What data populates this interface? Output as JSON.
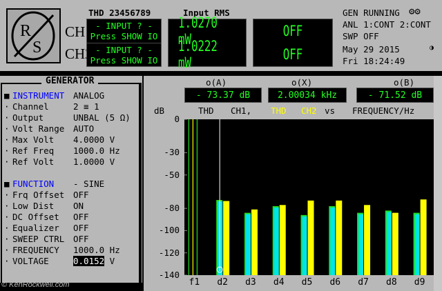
{
  "header": {
    "thd_label": "THD 23456789",
    "input_rms_label": "Input RMS",
    "logo_text": "R/S",
    "ch1_label": "CH1",
    "ch2_label": "CH2",
    "ch1_lines": [
      "- INPUT ? -",
      "Press SHOW IO"
    ],
    "ch2_lines": [
      "- INPUT ? -",
      "Press SHOW IO"
    ],
    "ch1_rms": "1.0270 mW",
    "ch2_rms": "1.0222 mW",
    "ch1_status": "OFF",
    "ch2_status": "OFF",
    "gen_running": "GEN RUNNING",
    "anl": "ANL 1:CONT 2:CONT",
    "swp": "SWP OFF",
    "date": "May 29 2015",
    "time": "Fri  18:24:49"
  },
  "generator": {
    "title": "GENERATOR",
    "rows": [
      {
        "mark": "■",
        "name": "INSTRUMENT",
        "value": "ANALOG",
        "head": true
      },
      {
        "mark": "·",
        "name": "Channel",
        "value": "2 ≡ 1"
      },
      {
        "mark": "·",
        "name": "Output",
        "value": "UNBAL (5 Ω)"
      },
      {
        "mark": "·",
        "name": "Volt Range",
        "value": "AUTO"
      },
      {
        "mark": "·",
        "name": "Max Volt",
        "value": "4.0000 V"
      },
      {
        "mark": "·",
        "name": "Ref Freq",
        "value": "1000.0 Hz"
      },
      {
        "mark": "·",
        "name": "Ref Volt",
        "value": "1.0000 V"
      },
      {
        "mark": "",
        "name": "",
        "value": ""
      },
      {
        "mark": "■",
        "name": "FUNCTION",
        "value": "- SINE",
        "head": true
      },
      {
        "mark": "·",
        "name": "Frq Offset",
        "value": "OFF"
      },
      {
        "mark": "·",
        "name": "Low Dist",
        "value": "ON"
      },
      {
        "mark": "·",
        "name": "DC Offset",
        "value": "OFF"
      },
      {
        "mark": "·",
        "name": "Equalizer",
        "value": "OFF"
      },
      {
        "mark": "·",
        "name": "SWEEP CTRL",
        "value": "OFF"
      },
      {
        "mark": "·",
        "name": "FREQUENCY",
        "value": "1000.0 Hz"
      },
      {
        "mark": "·",
        "name": "VOLTAGE",
        "value_selected": "0.0152",
        "value": " V"
      }
    ]
  },
  "graph": {
    "cursor_a_label": "o(A)",
    "cursor_x_label": "o(X)",
    "cursor_b_label": "o(B)",
    "cursor_a_value": "- 73.37 dB",
    "cursor_x_value": "2.00034 kHz",
    "cursor_b_value": "- 71.52 dB",
    "y_unit": "dB",
    "legend_thd": "THD",
    "legend_ch1": "CH1,",
    "legend_thd_y": "THD",
    "legend_ch2": "CH2",
    "legend_vs": "vs",
    "legend_freq": "FREQUENCY/Hz"
  },
  "chart_data": {
    "type": "bar",
    "categories": [
      "f1",
      "d2",
      "d3",
      "d4",
      "d5",
      "d6",
      "d7",
      "d8",
      "d9"
    ],
    "ylim": [
      -140,
      0
    ],
    "yticks": [
      0,
      -30,
      -50,
      -80,
      -100,
      -120,
      -140
    ],
    "series": [
      {
        "name": "THD CH1",
        "color": "#ffff00",
        "values": [
          0,
          -73.4,
          -81,
          -77,
          -73,
          -73,
          -77,
          -84,
          -72
        ]
      },
      {
        "name": "CH2",
        "color": "#00e5e5",
        "values": [
          0,
          -72.5,
          -84,
          -78,
          -86,
          -78,
          -84,
          -82,
          -84
        ]
      }
    ],
    "green_color": "#22dd22"
  },
  "watermark": "© KenRockwell.com"
}
